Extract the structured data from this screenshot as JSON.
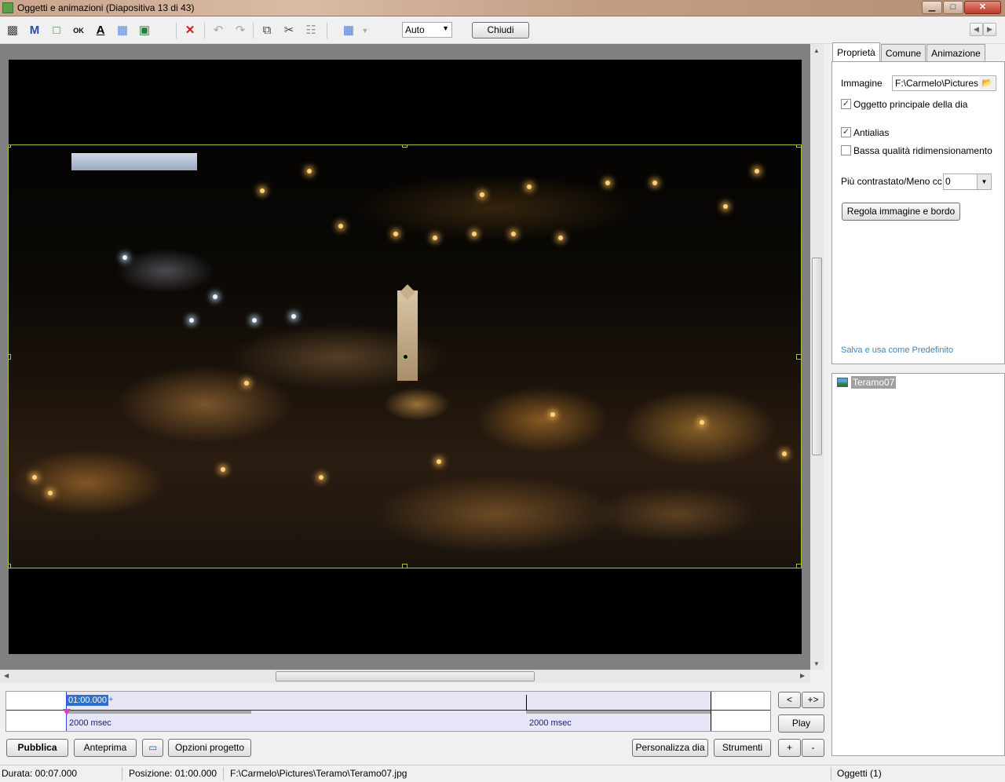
{
  "window": {
    "title": "Oggetti e animazioni  (Diapositiva 13 di 43)",
    "controls": {
      "minimize": "▁",
      "maximize": "□",
      "close": "✕"
    }
  },
  "toolbar": {
    "icons": [
      "camera-icon",
      "text-m-icon",
      "rectangle-icon",
      "ok-button-icon",
      "text-a-icon",
      "frame-icon",
      "image-icon",
      "delete-icon",
      "undo-icon",
      "redo-icon",
      "copy-icon",
      "cut-icon",
      "paste-icon",
      "grid-icon"
    ],
    "zoom_value": "Auto",
    "close_label": "Chiudi",
    "nav_prev": "◀",
    "nav_next": "▶"
  },
  "timeline": {
    "current_time": "01:00.000",
    "plus": "+",
    "segment1_label": "2000 msec",
    "segment2_label": "2000 msec"
  },
  "timeline_buttons": {
    "prev": "<",
    "next": "+>",
    "play": "Play"
  },
  "bottom_buttons": {
    "publish": "Pubblica",
    "preview": "Anteprima",
    "project_options": "Opzioni progetto",
    "customize_slide": "Personalizza dia",
    "tools": "Strumenti",
    "plus": "+",
    "minus": "-"
  },
  "status": {
    "duration": "Durata:  00:07.000",
    "position": "Posizione:  01:00.000",
    "file": "F:\\Carmelo\\Pictures\\Teramo\\Teramo07.jpg",
    "objects": "Oggetti (1)"
  },
  "tabs": {
    "properties": "Proprietà",
    "common": "Comune",
    "animation": "Animazione"
  },
  "properties": {
    "image_label": "Immagine",
    "image_path": "F:\\Carmelo\\Pictures",
    "main_object_label": "Oggetto principale della dia",
    "main_object_checked": "✓",
    "antialias_label": "Antialias",
    "antialias_checked": "✓",
    "low_quality_label": "Bassa qualità ridimensionamento",
    "contrast_label": "Più contrastato/Meno cc",
    "contrast_value": "0",
    "adjust_button": "Regola immagine e bordo",
    "save_default_link": "Salva e usa come Predefinito"
  },
  "objects": {
    "items": [
      {
        "label": "Teramo07"
      }
    ]
  },
  "colors": {
    "selection_border": "#a9c340",
    "link": "#3a87c8",
    "timeline_band": "#e6e6f8",
    "time_highlight": "#3070c8"
  }
}
